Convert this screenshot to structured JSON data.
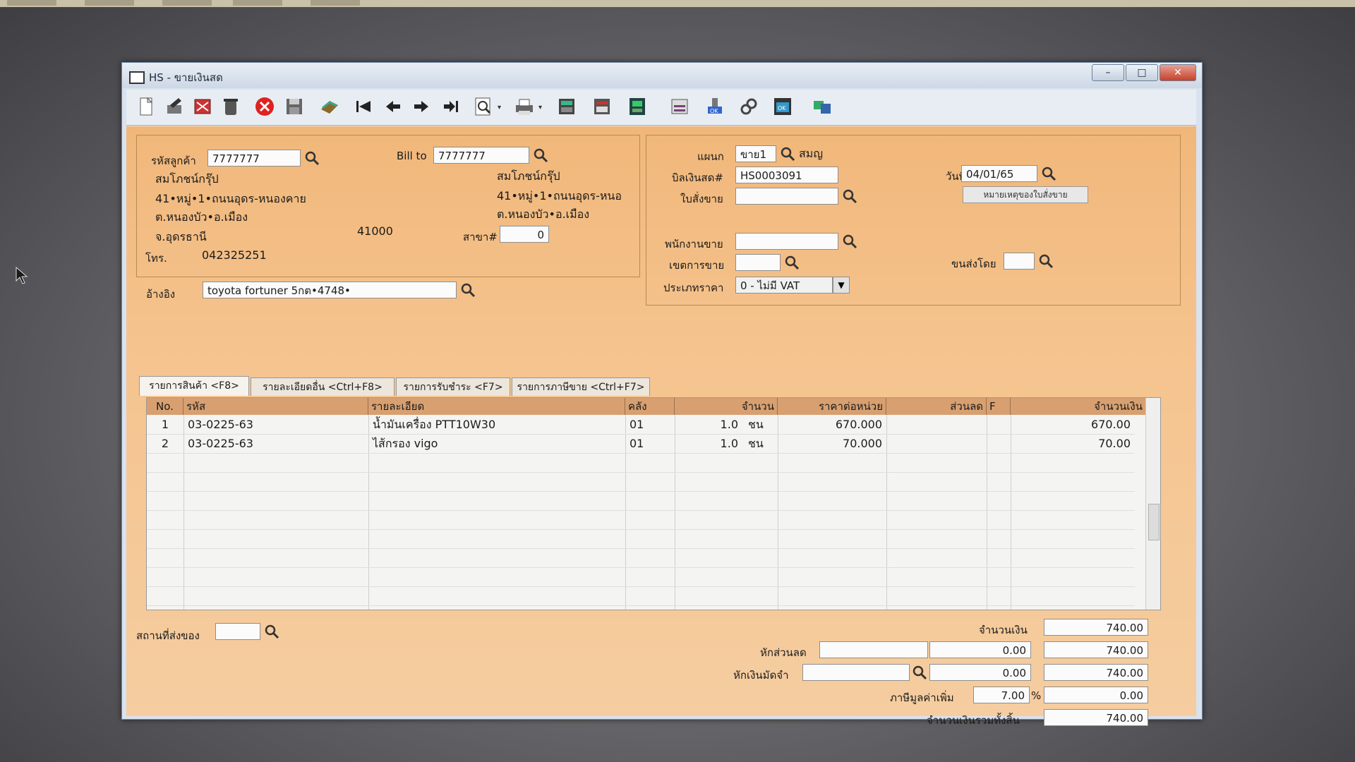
{
  "window": {
    "title": "HS - ขายเงินสด",
    "controls": [
      "–",
      "□",
      "✕"
    ]
  },
  "toolbar": {
    "icons": [
      "new-document-icon",
      "edit-icon",
      "cancel-document-icon",
      "delete-icon",
      "close-icon",
      "save-icon",
      "records-icon",
      "first-record-icon",
      "previous-record-icon",
      "next-record-icon",
      "last-record-icon",
      "search-icon",
      "print-icon",
      "calculator-icon",
      "report-icon",
      "slip-icon",
      "receipt-icon",
      "approve-icon",
      "tools-icon",
      "confirm-icon",
      "exchange-icon"
    ]
  },
  "customer": {
    "code_label": "รหัสลูกค้า",
    "code": "7777777",
    "name": "สมโภชน์กรุ๊ป",
    "address1": "41•หมู่•1•ถนนอุดร-หนองคาย",
    "address2": "ต.หนองบัว•อ.เมือง",
    "address3": "จ.อุดรธานี",
    "postcode": "41000",
    "phone_label": "โทร.",
    "phone": "042325251",
    "ref_label": "อ้างอิง",
    "ref": "toyota fortuner 5กต•4748•"
  },
  "billto": {
    "label": "Bill to",
    "code": "7777777",
    "name": "สมโภชน์กรุ๊ป",
    "address1": "41•หมู่•1•ถนนอุดร-หนอ",
    "address2": "ต.หนองบัว•อ.เมือง",
    "branch_label": "สาขา#",
    "branch": "0"
  },
  "doc": {
    "dept_label": "แผนก",
    "dept": "ขาย1",
    "dept_name": "สมญ",
    "bill_label": "บิลเงินสด#",
    "bill": "HS0003091",
    "order_label": "ใบสั่งขาย",
    "order": "",
    "date_label": "วันที่",
    "date": "04/01/65",
    "note_button": "หมายเหตุของใบสั่งขาย",
    "salesman_label": "พนักงานขาย",
    "salesman": "",
    "area_label": "เขตการขาย",
    "area": "",
    "shipby_label": "ขนส่งโดย",
    "shipby": "",
    "pricetype_label": "ประเภทราคา",
    "pricetype": "0 - ไม่มี VAT"
  },
  "tabs": [
    "รายการสินค้า <F8>",
    "รายละเอียดอื่น <Ctrl+F8>",
    "รายการรับชำระ <F7>",
    "รายการภาษีขาย <Ctrl+F7>"
  ],
  "grid": {
    "headers": [
      "No.",
      "รหัส",
      "รายละเอียด",
      "คลัง",
      "จำนวน",
      "ราคาต่อหน่วย",
      "ส่วนลด",
      "F",
      "จำนวนเงิน"
    ],
    "rows": [
      {
        "no": "1",
        "code": "03-0225-63",
        "desc": "น้ำมันเครื่อง PTT10W30",
        "wh": "01",
        "qty": "1.0",
        "unit": "ชน",
        "price": "670.000",
        "disc": "",
        "f": "",
        "amount": "670.00"
      },
      {
        "no": "2",
        "code": "03-0225-63",
        "desc": "ไส้กรอง vigo",
        "wh": "01",
        "qty": "1.0",
        "unit": "ชน",
        "price": "70.000",
        "disc": "",
        "f": "",
        "amount": "70.00"
      }
    ]
  },
  "summary": {
    "ship_label": "สถานที่ส่งของ",
    "ship": "",
    "amount_label": "จำนวนเงิน",
    "amount": "740.00",
    "discount_label": "หักส่วนลด",
    "discount_input": "",
    "discount_value": "0.00",
    "discount_total": "740.00",
    "deposit_label": "หักเงินมัดจำ",
    "deposit_input": "",
    "deposit_value": "0.00",
    "deposit_total": "740.00",
    "vat_label": "ภาษีมูลค่าเพิ่ม",
    "vat_rate": "7.00",
    "vat_pct": "%",
    "vat_value": "0.00",
    "grand_label": "จำนวนเงินรวมทั้งสิ้น",
    "grand": "740.00"
  }
}
